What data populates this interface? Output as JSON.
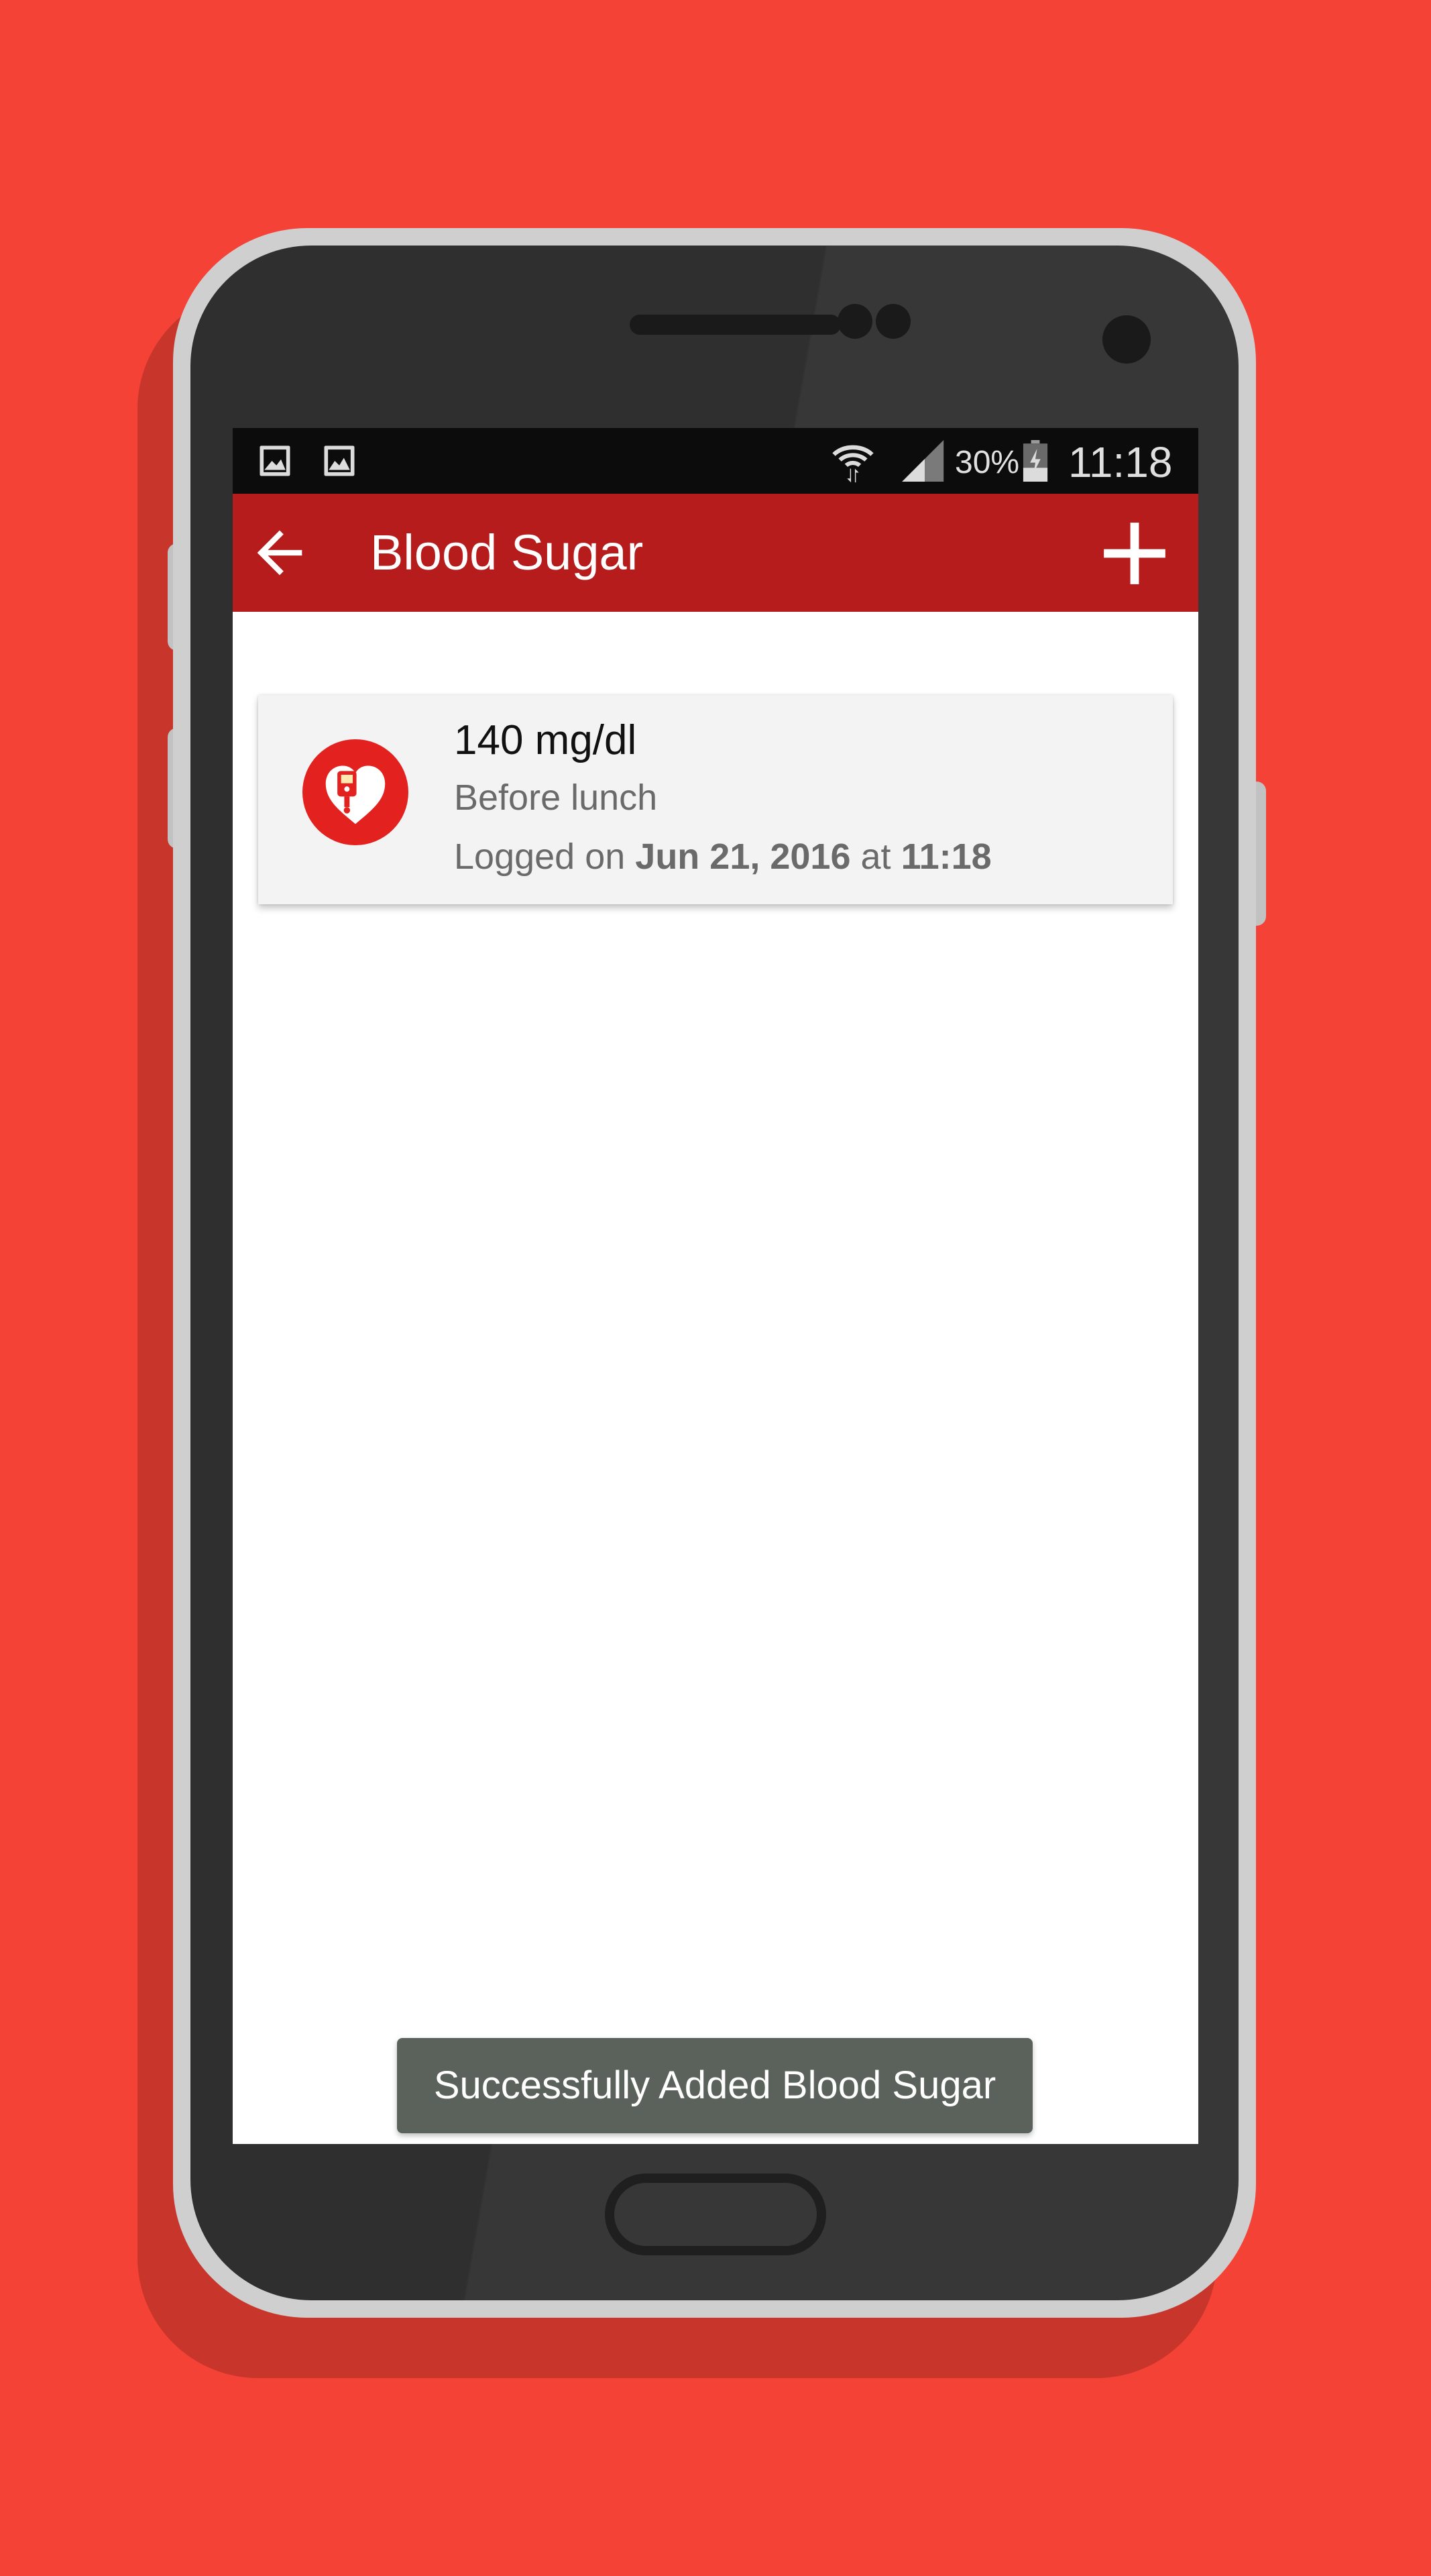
{
  "status_bar": {
    "battery": "30%",
    "time": "11:18",
    "icons": [
      "gallery-notification-icon",
      "gallery-notification-icon",
      "wifi-icon",
      "signal-icon",
      "battery-charging-icon"
    ]
  },
  "toolbar": {
    "title": "Blood Sugar",
    "back_icon": "arrow-left-icon",
    "add_icon": "plus-icon",
    "color": "#b71c1c"
  },
  "entries": [
    {
      "value": "140 mg/dl",
      "type": "Before lunch",
      "logged_prefix": "Logged on",
      "date": "Jun 21, 2016",
      "at": "at",
      "time": "11:18",
      "icon": "glucose-meter-heart-icon"
    }
  ],
  "toast": {
    "message": "Successfully Added Blood Sugar"
  },
  "colors": {
    "background": "#f44336",
    "accent": "#e3211f",
    "toast": "#5b625b"
  }
}
